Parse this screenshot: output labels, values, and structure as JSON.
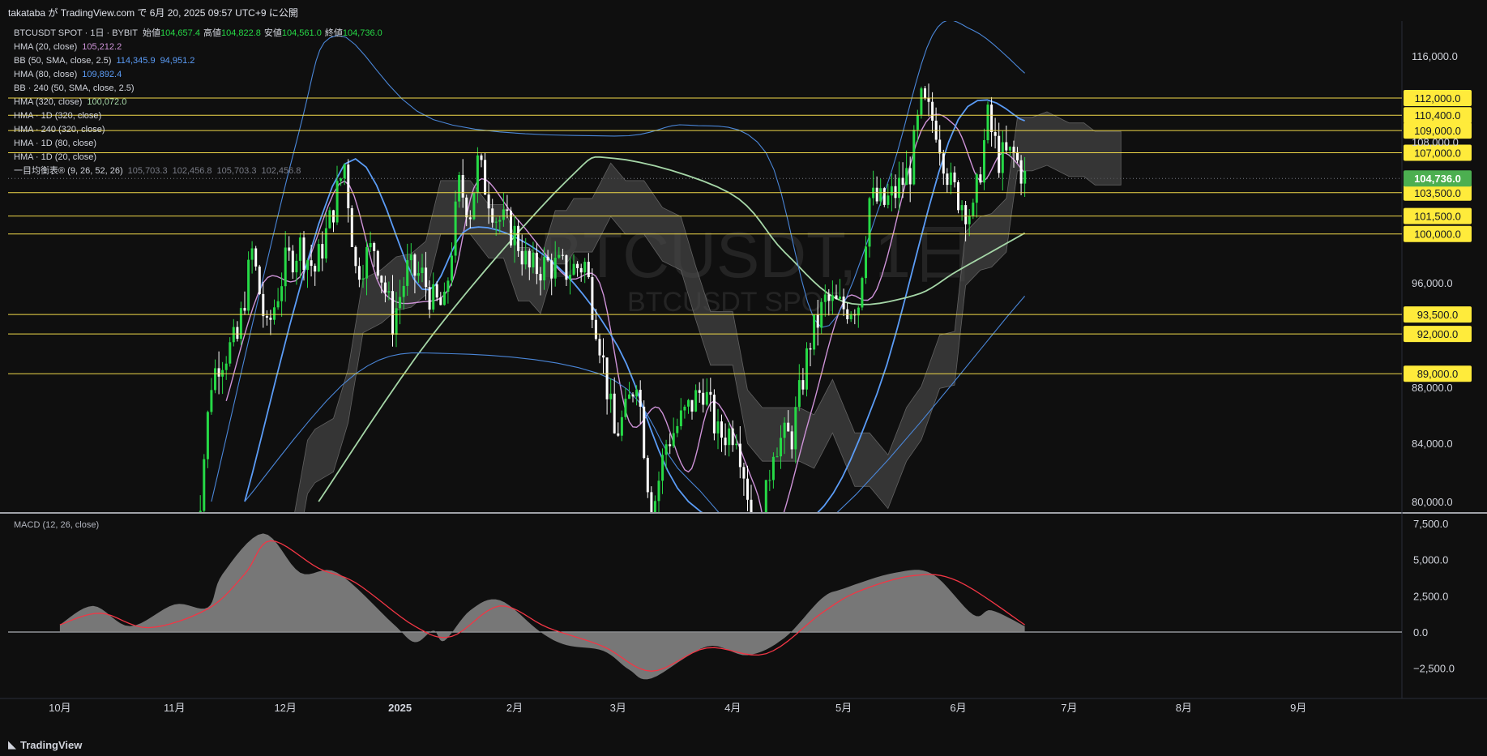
{
  "header": {
    "publish_line": "takataba が TradingView.com で 6月 20, 2025 09:57 UTC+9 に公開"
  },
  "footer": {
    "brand": "TradingView"
  },
  "legend": {
    "symbol_line": "BTCUSDT SPOT · 1日 · BYBIT",
    "ohlc": [
      {
        "label": "始値",
        "value": "104,657.4"
      },
      {
        "label": "高値",
        "value": "104,822.8"
      },
      {
        "label": "安値",
        "value": "104,561.0"
      },
      {
        "label": "終値",
        "value": "104,736.0"
      }
    ],
    "indicators": [
      {
        "name": "HMA (20, close)",
        "values": [
          "105,212.2"
        ],
        "color": "#ce93d8"
      },
      {
        "name": "BB (50, SMA, close, 2.5)",
        "values": [
          "114,345.9",
          "94,951.2"
        ],
        "color": "#5b9cf6"
      },
      {
        "name": "HMA (80, close)",
        "values": [
          "109,892.4"
        ],
        "color": "#5b9cf6"
      },
      {
        "name": "BB · 240 (50, SMA, close, 2.5)",
        "values": [],
        "color": "#b2b5be"
      },
      {
        "name": "HMA (320, close)",
        "values": [
          "100,072.0"
        ],
        "color": "#a5d6a7"
      },
      {
        "name": "HMA · 1D (320, close)",
        "values": [],
        "color": "#b2b5be"
      },
      {
        "name": "HMA · 240 (320, close)",
        "values": [],
        "color": "#b2b5be"
      },
      {
        "name": "HMA · 1D (80, close)",
        "values": [],
        "color": "#b2b5be"
      },
      {
        "name": "HMA · 1D (20, close)",
        "values": [],
        "color": "#b2b5be"
      },
      {
        "name": "一目均衡表® (9, 26, 52, 26)",
        "values": [
          "105,703.3",
          "102,456.8",
          "105,703.3",
          "102,456.8"
        ],
        "color": "#787b86"
      }
    ]
  },
  "watermark": {
    "line1": "BTCUSDT, 1日",
    "line2": "BTCUSDT SPOT"
  },
  "macd_label": "MACD (12, 26, close)",
  "colors": {
    "background": "#0f0f0f",
    "bull": "#26d946",
    "bear": "#ffffff",
    "level_line": "#f0d94a",
    "level_label_bg": "#ffeb3b",
    "current_price_bg": "#4caf50",
    "hma20": "#ce93d8",
    "hma80": "#5b9cf6",
    "hma320": "#a5d6a7",
    "bb": "#4a86d8",
    "cloud": "#4a4a4a",
    "macd_area": "#8a8a8a",
    "signal": "#f23645"
  },
  "chart_data": {
    "type": "line",
    "title": "BTCUSDT, 1日",
    "x_axis_labels": [
      "10月",
      "11月",
      "12月",
      "2025",
      "2月",
      "3月",
      "4月",
      "5月",
      "6月",
      "7月",
      "8月",
      "9月"
    ],
    "price_axis": {
      "ticks": [
        "116,000.0",
        "108,000.0",
        "96,000.0",
        "88,000.0",
        "84,000.0",
        "80,000.0"
      ],
      "ylim": [
        80000,
        118000
      ],
      "scale": "log"
    },
    "horizontal_levels": [
      "112,000.0",
      "110,400.0",
      "109,000.0",
      "107,000.0",
      "103,500.0",
      "101,500.0",
      "100,000.0",
      "93,500.0",
      "92,000.0",
      "89,000.0"
    ],
    "current_price": "104,736.0",
    "candles": {
      "note": "daily BTCUSDT candles",
      "close_points": [
        [
          "2024-11-06",
          75000
        ],
        [
          "2024-11-11",
          88500
        ],
        [
          "2024-11-13",
          90000
        ],
        [
          "2024-11-18",
          91500
        ],
        [
          "2024-11-22",
          98500
        ],
        [
          "2024-11-26",
          92000
        ],
        [
          "2024-12-01",
          97500
        ],
        [
          "2024-12-05",
          99000
        ],
        [
          "2024-12-09",
          97000
        ],
        [
          "2024-12-13",
          101000
        ],
        [
          "2024-12-17",
          106000
        ],
        [
          "2024-12-20",
          97000
        ],
        [
          "2024-12-25",
          99000
        ],
        [
          "2024-12-30",
          93000
        ],
        [
          "2025-01-03",
          97000
        ],
        [
          "2025-01-07",
          96500
        ],
        [
          "2025-01-10",
          94500
        ],
        [
          "2025-01-13",
          94000
        ],
        [
          "2025-01-17",
          104000
        ],
        [
          "2025-01-20",
          102000
        ],
        [
          "2025-01-22",
          106000
        ],
        [
          "2025-01-27",
          101500
        ],
        [
          "2025-02-01",
          100000
        ],
        [
          "2025-02-05",
          97000
        ],
        [
          "2025-02-10",
          97500
        ],
        [
          "2025-02-15",
          97000
        ],
        [
          "2025-02-20",
          97500
        ],
        [
          "2025-02-24",
          91500
        ],
        [
          "2025-02-28",
          84500
        ],
        [
          "2025-03-03",
          86000
        ],
        [
          "2025-03-06",
          89000
        ],
        [
          "2025-03-10",
          79000
        ],
        [
          "2025-03-14",
          84000
        ],
        [
          "2025-03-19",
          86000
        ],
        [
          "2025-03-24",
          88000
        ],
        [
          "2025-03-28",
          84500
        ],
        [
          "2025-04-02",
          85000
        ],
        [
          "2025-04-08",
          76500
        ],
        [
          "2025-04-12",
          84000
        ],
        [
          "2025-04-17",
          84500
        ],
        [
          "2025-04-22",
          91500
        ],
        [
          "2025-04-26",
          94500
        ],
        [
          "2025-05-01",
          94000
        ],
        [
          "2025-05-05",
          94500
        ],
        [
          "2025-05-08",
          103000
        ],
        [
          "2025-05-12",
          102500
        ],
        [
          "2025-05-15",
          103500
        ],
        [
          "2025-05-19",
          105500
        ],
        [
          "2025-05-22",
          111500
        ],
        [
          "2025-05-26",
          109500
        ],
        [
          "2025-05-30",
          104000
        ],
        [
          "2025-06-05",
          101500
        ],
        [
          "2025-06-09",
          110000
        ],
        [
          "2025-06-12",
          106500
        ],
        [
          "2025-06-16",
          106800
        ],
        [
          "2025-06-19",
          104736
        ]
      ]
    },
    "series": [
      {
        "name": "HMA (20, close)",
        "points": [
          [
            "2024-11-15",
            87000
          ],
          [
            "2024-11-25",
            96000
          ],
          [
            "2024-12-05",
            96500
          ],
          [
            "2024-12-17",
            104500
          ],
          [
            "2024-12-27",
            95500
          ],
          [
            "2025-01-07",
            94500
          ],
          [
            "2025-01-15",
            96000
          ],
          [
            "2025-01-22",
            104500
          ],
          [
            "2025-02-01",
            101500
          ],
          [
            "2025-02-15",
            96500
          ],
          [
            "2025-02-24",
            96000
          ],
          [
            "2025-03-04",
            85500
          ],
          [
            "2025-03-12",
            86500
          ],
          [
            "2025-03-20",
            82000
          ],
          [
            "2025-03-27",
            87000
          ],
          [
            "2025-04-07",
            81000
          ],
          [
            "2025-04-12",
            77500
          ],
          [
            "2025-04-22",
            86000
          ],
          [
            "2025-05-01",
            94500
          ],
          [
            "2025-05-10",
            95500
          ],
          [
            "2025-05-22",
            109000
          ],
          [
            "2025-05-31",
            109500
          ],
          [
            "2025-06-07",
            104500
          ],
          [
            "2025-06-13",
            107000
          ],
          [
            "2025-06-19",
            105212
          ]
        ]
      },
      {
        "name": "HMA (80, close)",
        "points": [
          [
            "2024-11-20",
            80000
          ],
          [
            "2024-12-17",
            106000
          ],
          [
            "2025-01-07",
            95500
          ],
          [
            "2025-01-20",
            100500
          ],
          [
            "2025-02-10",
            98000
          ],
          [
            "2025-03-01",
            91000
          ],
          [
            "2025-03-20",
            80000
          ],
          [
            "2025-04-20",
            78500
          ],
          [
            "2025-05-10",
            87500
          ],
          [
            "2025-06-01",
            110000
          ],
          [
            "2025-06-19",
            109892
          ]
        ]
      },
      {
        "name": "HMA (320, close)",
        "points": [
          [
            "2024-12-10",
            80000
          ],
          [
            "2025-01-10",
            92000
          ],
          [
            "2025-02-15",
            104500
          ],
          [
            "2025-02-28",
            106500
          ],
          [
            "2025-03-31",
            103500
          ],
          [
            "2025-04-15",
            98500
          ],
          [
            "2025-05-01",
            94500
          ],
          [
            "2025-05-20",
            95000
          ],
          [
            "2025-06-01",
            97000
          ],
          [
            "2025-06-19",
            100072
          ]
        ]
      },
      {
        "name": "BB (50, SMA, close, 2.5) upper",
        "points": [
          [
            "2024-11-11",
            80000
          ],
          [
            "2024-12-04",
            108000
          ],
          [
            "2024-12-15",
            118000
          ],
          [
            "2025-01-10",
            110000
          ],
          [
            "2025-02-28",
            108500
          ],
          [
            "2025-03-20",
            109500
          ],
          [
            "2025-04-10",
            107000
          ],
          [
            "2025-04-25",
            92500
          ],
          [
            "2025-05-12",
            103500
          ],
          [
            "2025-05-25",
            118000
          ],
          [
            "2025-06-05",
            118500
          ],
          [
            "2025-06-19",
            114346
          ]
        ]
      },
      {
        "name": "BB (50, SMA, close, 2.5) lower",
        "points": [
          [
            "2024-11-20",
            80000
          ],
          [
            "2024-12-20",
            89000
          ],
          [
            "2025-01-15",
            90500
          ],
          [
            "2025-02-28",
            88500
          ],
          [
            "2025-03-20",
            81500
          ],
          [
            "2025-04-20",
            77500
          ],
          [
            "2025-06-19",
            94951
          ]
        ]
      }
    ],
    "macd": {
      "ticks": [
        "7,500.0",
        "5,000.0",
        "2,500.0",
        "0.0",
        "−2,500.0"
      ],
      "ylim": [
        -3500,
        7500
      ],
      "macd_points": [
        [
          "2024-10-01",
          500
        ],
        [
          "2024-10-10",
          1800
        ],
        [
          "2024-10-20",
          400
        ],
        [
          "2024-11-01",
          1900
        ],
        [
          "2024-11-10",
          1700
        ],
        [
          "2024-11-14",
          4000
        ],
        [
          "2024-11-25",
          6800
        ],
        [
          "2024-12-05",
          4100
        ],
        [
          "2024-12-15",
          4100
        ],
        [
          "2024-12-30",
          600
        ],
        [
          "2025-01-05",
          -700
        ],
        [
          "2025-01-10",
          100
        ],
        [
          "2025-01-13",
          -600
        ],
        [
          "2025-01-20",
          1500
        ],
        [
          "2025-01-28",
          2200
        ],
        [
          "2025-02-08",
          0
        ],
        [
          "2025-02-15",
          -900
        ],
        [
          "2025-02-25",
          -1300
        ],
        [
          "2025-03-04",
          -2600
        ],
        [
          "2025-03-10",
          -3200
        ],
        [
          "2025-03-25",
          -1000
        ],
        [
          "2025-04-05",
          -1600
        ],
        [
          "2025-04-15",
          -400
        ],
        [
          "2025-04-25",
          2300
        ],
        [
          "2025-05-01",
          3000
        ],
        [
          "2025-05-15",
          4100
        ],
        [
          "2025-05-25",
          4000
        ],
        [
          "2025-06-05",
          1200
        ],
        [
          "2025-06-10",
          1500
        ],
        [
          "2025-06-19",
          400
        ]
      ],
      "signal_points": [
        [
          "2024-10-01",
          500
        ],
        [
          "2024-10-12",
          1300
        ],
        [
          "2024-10-25",
          300
        ],
        [
          "2024-11-10",
          1600
        ],
        [
          "2024-11-20",
          4000
        ],
        [
          "2024-11-27",
          6300
        ],
        [
          "2024-12-10",
          4400
        ],
        [
          "2024-12-20",
          3400
        ],
        [
          "2025-01-05",
          400
        ],
        [
          "2025-01-15",
          -300
        ],
        [
          "2025-01-28",
          1800
        ],
        [
          "2025-02-10",
          300
        ],
        [
          "2025-02-25",
          -1000
        ],
        [
          "2025-03-10",
          -2700
        ],
        [
          "2025-03-25",
          -1100
        ],
        [
          "2025-04-10",
          -1500
        ],
        [
          "2025-04-25",
          1300
        ],
        [
          "2025-05-05",
          2800
        ],
        [
          "2025-05-20",
          3900
        ],
        [
          "2025-06-01",
          3500
        ],
        [
          "2025-06-19",
          500
        ]
      ]
    }
  }
}
